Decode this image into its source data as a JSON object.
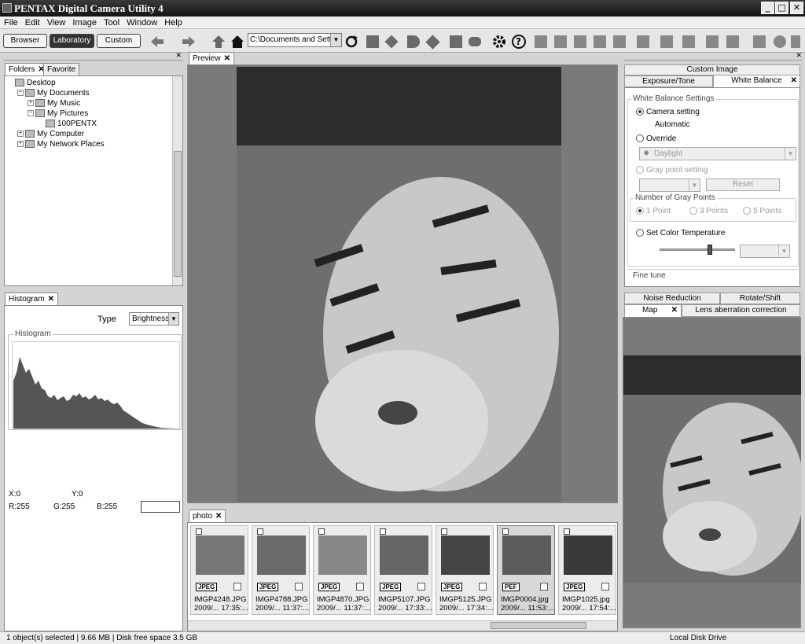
{
  "window": {
    "title": "PENTAX Digital Camera Utility 4",
    "min": "_",
    "max": "□",
    "close": "✕"
  },
  "menu": [
    "File",
    "Edit",
    "View",
    "Image",
    "Tool",
    "Window",
    "Help"
  ],
  "toolbar": {
    "modes": [
      "Browser",
      "Laboratory",
      "Custom"
    ],
    "path": "C:\\Documents and Setting"
  },
  "folders": {
    "tabs": [
      "Folders",
      "Favorite"
    ],
    "tree": [
      {
        "label": "Desktop",
        "indent": 0,
        "pm": ""
      },
      {
        "label": "My Documents",
        "indent": 1,
        "pm": "−"
      },
      {
        "label": "My Music",
        "indent": 2,
        "pm": "+"
      },
      {
        "label": "My Pictures",
        "indent": 2,
        "pm": "−"
      },
      {
        "label": "100PENTX",
        "indent": 3,
        "pm": ""
      },
      {
        "label": "My Computer",
        "indent": 1,
        "pm": "+"
      },
      {
        "label": "My Network Places",
        "indent": 1,
        "pm": "+"
      }
    ]
  },
  "histogram": {
    "tab": "Histogram",
    "type_label": "Type",
    "type_value": "Brightness",
    "group": "Histogram",
    "x": "X:0",
    "y": "Y:0",
    "r": "R:255",
    "g": "G:255",
    "b": "B:255"
  },
  "preview": {
    "tab": "Preview"
  },
  "photo": {
    "tab": "photo",
    "items": [
      {
        "name": "IMGP4248.JPG",
        "date": "2009/...  17:35:...",
        "fmt": "JPEG"
      },
      {
        "name": "IMGP4788.JPG",
        "date": "2009/...  11:37:...",
        "fmt": "JPEG"
      },
      {
        "name": "IMGP4870.JPG",
        "date": "2009/...  11:37:...",
        "fmt": "JPEG"
      },
      {
        "name": "IMGP5107.JPG",
        "date": "2009/...  17:33:...",
        "fmt": "JPEG"
      },
      {
        "name": "IMGP5125.JPG",
        "date": "2009/...  17:34:...",
        "fmt": "JPEG"
      },
      {
        "name": "IMGP0004.jpg",
        "date": "2009/...  11:53:...",
        "fmt": "PEF"
      },
      {
        "name": "IMGP1025.jpg",
        "date": "2009/...  17:54:...",
        "fmt": "JPEG"
      }
    ]
  },
  "custom": {
    "title": "Custom Image",
    "tabs": [
      "Exposure/Tone",
      "White Balance"
    ],
    "wb_group": "White Balance Settings",
    "camera_setting": "Camera setting",
    "automatic": "Automatic",
    "override": "Override",
    "daylight": "Daylight",
    "gray_point": "Gray point setting",
    "reset": "Reset",
    "gray_points_group": "Number of Gray Points",
    "points": [
      "1 Point",
      "3 Points",
      "5 Points"
    ],
    "color_temp": "Set Color Temperature",
    "fine_tune": "Fine tune"
  },
  "lower_tabs": {
    "row1": [
      "Noise Reduction",
      "Rotate/Shift"
    ],
    "row2": [
      "Map",
      "Lens aberration correction"
    ]
  },
  "status": {
    "left": "1 object(s) selected | 9.66 MB | Disk free space 3.5 GB",
    "right": "Local Disk Drive"
  },
  "colors": {
    "titlebar": "#1e1e1e",
    "panel": "#ffffff",
    "workspace": "#7a7a7a"
  },
  "icons": [
    "back-arrow-icon",
    "forward-arrow-icon",
    "up-arrow-icon",
    "home-icon",
    "refresh-icon",
    "gear-icon",
    "help-icon"
  ]
}
